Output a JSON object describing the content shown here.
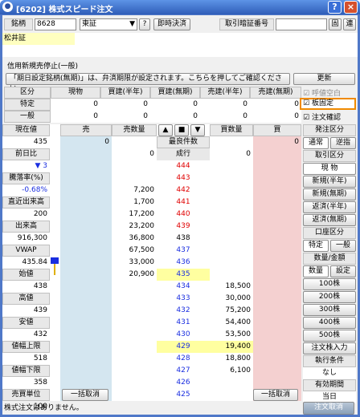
{
  "window": {
    "title": "[6202] 株式スピード注文",
    "help": "?",
    "close": "×"
  },
  "header": {
    "code_label": "銘柄",
    "code": "8628",
    "market": "東証",
    "q": "?",
    "instant": "即時決済",
    "pin_label": "取引暗証番号",
    "pin_btn": "固",
    "conn_btn": "連"
  },
  "name": "松井証",
  "notice": {
    "credit": "信用新規売停止(一般)",
    "msg": "「期日設定銘柄(無期)」は、弁済期限が設定されます。こちらを押してご確認ください。",
    "update": "更新"
  },
  "pos_table": {
    "headers": [
      "区分",
      "現物",
      "買建(半年)",
      "買建(無期)",
      "売建(半年)",
      "売建(無期)"
    ],
    "rows": [
      {
        "label": "特定",
        "values": [
          "0",
          "0",
          "0",
          "0",
          "0"
        ]
      },
      {
        "label": "一般",
        "values": [
          "0",
          "0",
          "0",
          "0",
          "0"
        ]
      }
    ]
  },
  "checks": {
    "quote_blank": "呼値空白",
    "board_fix": "板固定",
    "order_confirm": "注文確認"
  },
  "board": {
    "headers": {
      "sell": "売",
      "sell_qty": "売数量",
      "mid": "最良件数",
      "buy_qty": "買数量",
      "buy": "買"
    },
    "sell_zero": "0",
    "mid_zero": "0",
    "buy_zero": "0",
    "market": "成行",
    "nav": [
      "▲",
      "■",
      "▼"
    ],
    "rows": [
      {
        "sq": "",
        "p": "444",
        "bq": ""
      },
      {
        "sq": "",
        "p": "443",
        "bq": ""
      },
      {
        "sq": "7,200",
        "p": "442",
        "bq": ""
      },
      {
        "sq": "1,700",
        "p": "441",
        "bq": ""
      },
      {
        "sq": "17,200",
        "p": "440",
        "bq": ""
      },
      {
        "sq": "23,200",
        "p": "439",
        "bq": ""
      },
      {
        "sq": "36,800",
        "p": "438",
        "bq": ""
      },
      {
        "sq": "67,500",
        "p": "437",
        "bq": ""
      },
      {
        "sq": "33,000",
        "p": "436",
        "bq": ""
      },
      {
        "sq": "20,900",
        "p": "435",
        "bq": ""
      },
      {
        "sq": "",
        "p": "434",
        "bq": "18,500"
      },
      {
        "sq": "",
        "p": "433",
        "bq": "30,000"
      },
      {
        "sq": "",
        "p": "432",
        "bq": "75,200"
      },
      {
        "sq": "",
        "p": "431",
        "bq": "54,400"
      },
      {
        "sq": "",
        "p": "430",
        "bq": "53,500"
      },
      {
        "sq": "",
        "p": "429",
        "bq": "19,400"
      },
      {
        "sq": "",
        "p": "428",
        "bq": "18,800"
      },
      {
        "sq": "",
        "p": "427",
        "bq": "6,100"
      },
      {
        "sq": "",
        "p": "426",
        "bq": ""
      },
      {
        "sq": "",
        "p": "425",
        "bq": ""
      }
    ],
    "cancel_sell": "一括取消",
    "cancel_buy": "一括取消"
  },
  "sidebar": [
    {
      "l": "現在値",
      "v": "435"
    },
    {
      "l": "前日比",
      "v": "▼ 3"
    },
    {
      "l": "騰落率(%)",
      "v": "-0.68%"
    },
    {
      "l": "直近出来高",
      "v": "200"
    },
    {
      "l": "出来高",
      "v": "916,300"
    },
    {
      "l": "VWAP",
      "v": "435.84"
    },
    {
      "l": "始値",
      "v": "438"
    },
    {
      "l": "高値",
      "v": "439"
    },
    {
      "l": "安値",
      "v": "432"
    },
    {
      "l": "値幅上限",
      "v": "518"
    },
    {
      "l": "値幅下限",
      "v": "358"
    },
    {
      "l": "売買単位",
      "v": "100"
    }
  ],
  "right": {
    "order_type": "発注区分",
    "normal": "通常",
    "reverse": "逆指",
    "trade_type": "取引区分",
    "spot": "現 物",
    "new_half": "新規(半年)",
    "new_inf": "新規(無期)",
    "ret_half": "返済(半年)",
    "ret_inf": "返済(無期)",
    "account": "口座区分",
    "tokutei": "特定",
    "ippan": "一般",
    "qty_amt": "数量/金額",
    "qty": "数量",
    "setting": "設定",
    "q100": "100株",
    "q200": "200株",
    "q300": "300株",
    "q400": "400株",
    "q500": "500株",
    "input": "注文株入力",
    "exec": "執行条件",
    "none": "なし",
    "expiry": "有効期間",
    "today": "当日",
    "order_cancel": "注文取消"
  },
  "status": "株式注文はありません。"
}
